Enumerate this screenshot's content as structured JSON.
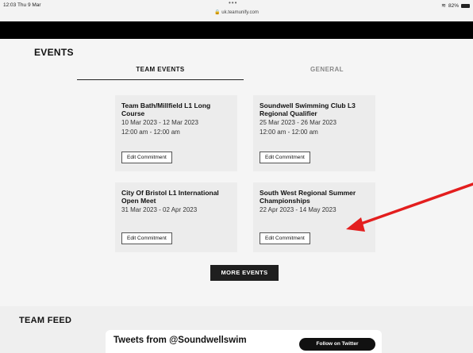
{
  "status": {
    "time": "12:03  Thu 9 Mar",
    "dots": "•••",
    "url": "uk.teamunify.com",
    "battery": "82%"
  },
  "events": {
    "title": "EVENTS",
    "tabs": [
      {
        "label": "TEAM EVENTS"
      },
      {
        "label": "GENERAL"
      }
    ],
    "cards": [
      {
        "name": "Team Bath/Millfield L1 Long Course",
        "dates": "10 Mar 2023  -  12 Mar 2023",
        "times": "12:00 am  -  12:00 am",
        "button": "Edit Commitment"
      },
      {
        "name": "Soundwell Swimming Club L3 Regional Qualifier",
        "dates": "25 Mar 2023  -  26 Mar 2023",
        "times": "12:00 am  -  12:00 am",
        "button": "Edit Commitment"
      },
      {
        "name": "City Of Bristol L1 International Open Meet",
        "dates": "31 Mar 2023  -  02 Apr 2023",
        "times": "",
        "button": "Edit Commitment"
      },
      {
        "name": "South West Regional Summer Championships",
        "dates": "22 Apr 2023  -  14 May 2023",
        "times": "",
        "button": "Edit Commitment"
      }
    ],
    "more_button": "MORE EVENTS"
  },
  "feed": {
    "title": "TEAM FEED",
    "tweets_title": "Tweets from @Soundwellswim",
    "follow_button": "Follow on Twitter"
  },
  "colors": {
    "annotation_arrow": "#e31e1e"
  }
}
